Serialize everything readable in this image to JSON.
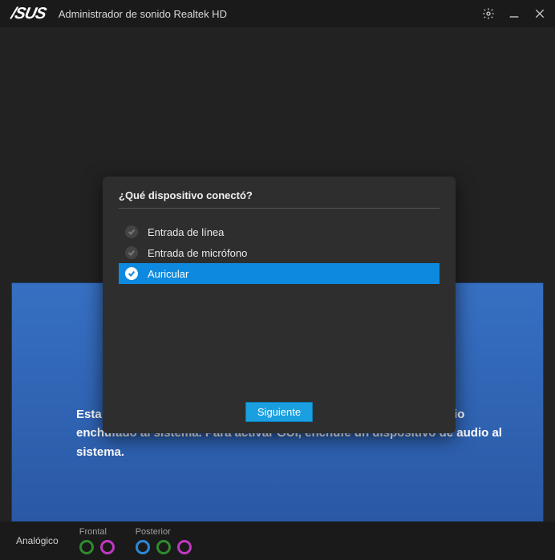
{
  "titlebar": {
    "logo": "/SUS",
    "title": "Administrador de sonido Realtek HD",
    "icons": {
      "settings": "gear",
      "minimize": "minimize",
      "close": "close"
    }
  },
  "blue_panel": {
    "text": "Esta página está desactivada ya que no hay un dispositivo de audio enchufado al sistema. Para activar GUI, enchufe un dispositivo de audio al sistema."
  },
  "modal": {
    "title": "¿Qué dispositivo conectó?",
    "options": [
      {
        "label": "Entrada de línea",
        "selected": false
      },
      {
        "label": "Entrada de micrófono",
        "selected": false
      },
      {
        "label": "Auricular",
        "selected": true
      }
    ],
    "next_button": "Siguiente"
  },
  "bottom": {
    "analog_label": "Analógico",
    "front_label": "Frontal",
    "rear_label": "Posterior",
    "front_jacks": [
      {
        "color": "#2e8b2e"
      },
      {
        "color": "#c038c0"
      }
    ],
    "rear_jacks": [
      {
        "color": "#2b88d8"
      },
      {
        "color": "#2e8b2e"
      },
      {
        "color": "#c038c0"
      }
    ]
  }
}
